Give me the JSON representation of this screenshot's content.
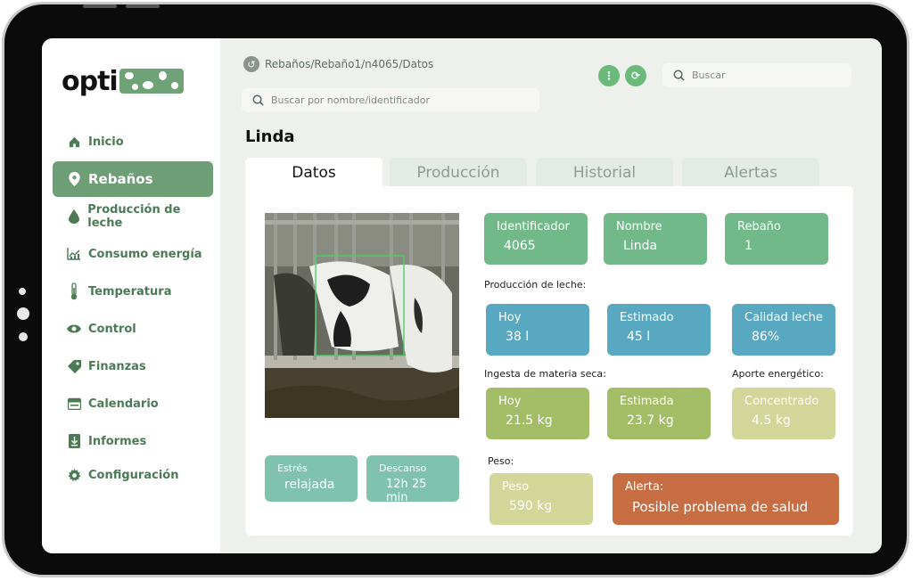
{
  "app": {
    "logo_text": "opti",
    "logo_badge": "muu"
  },
  "sidebar": {
    "items": [
      {
        "label": "Inicio",
        "icon": "home-icon",
        "active": false
      },
      {
        "label": "Rebaños",
        "icon": "location-pin-icon",
        "active": true
      },
      {
        "label": "Producción de leche",
        "icon": "drop-icon",
        "active": false
      },
      {
        "label": "Consumo energía",
        "icon": "chart-icon",
        "active": false
      },
      {
        "label": "Temperatura",
        "icon": "thermometer-icon",
        "active": false
      },
      {
        "label": "Control",
        "icon": "eye-icon",
        "active": false
      },
      {
        "label": "Finanzas",
        "icon": "tag-icon",
        "active": false
      },
      {
        "label": "Calendario",
        "icon": "calendar-icon",
        "active": false
      },
      {
        "label": "Informes",
        "icon": "download-icon",
        "active": false
      },
      {
        "label": "Configuración",
        "icon": "gear-icon",
        "active": false
      }
    ]
  },
  "header": {
    "breadcrumb": "Rebaños/Rebaño1/n4065/Datos",
    "search_main_placeholder": "Buscar por nombre/identificador",
    "search_top_placeholder": "Buscar"
  },
  "page": {
    "title": "Linda",
    "tabs": [
      {
        "label": "Datos",
        "active": true
      },
      {
        "label": "Producción",
        "active": false
      },
      {
        "label": "Historial",
        "active": false
      },
      {
        "label": "Alertas",
        "active": false
      }
    ]
  },
  "info": {
    "identificador": {
      "label": "Identificador",
      "value": "4065"
    },
    "nombre": {
      "label": "Nombre",
      "value": "Linda"
    },
    "rebano": {
      "label": "Rebaño",
      "value": "1"
    }
  },
  "milk": {
    "section": "Producción de leche:",
    "hoy": {
      "label": "Hoy",
      "value": "38 l"
    },
    "estimado": {
      "label": "Estimado",
      "value": "45 l"
    },
    "calidad": {
      "label": "Calidad leche",
      "value": "86%"
    }
  },
  "intake": {
    "section": "Ingesta de materia seca:",
    "hoy": {
      "label": "Hoy",
      "value": "21.5 kg"
    },
    "estimada": {
      "label": "Estimada",
      "value": "23.7 kg"
    }
  },
  "energy": {
    "section": "Aporte energético:",
    "concentrado": {
      "label": "Concentrado",
      "value": "4.5 kg"
    }
  },
  "weight": {
    "section": "Peso:",
    "peso": {
      "label": "Peso",
      "value": "590 kg"
    }
  },
  "status": {
    "estres": {
      "label": "Estrés",
      "value": "relajada"
    },
    "descanso": {
      "label": "Descanso",
      "value": "12h 25 min"
    }
  },
  "alert": {
    "label": "Alerta:",
    "value": "Posible problema de salud"
  },
  "colors": {
    "accent": "#6e9e76",
    "green": "#72b98a",
    "blue": "#58a8c2",
    "olive": "#a3bd67",
    "sand": "#d2d699",
    "teal": "#7fc2ad",
    "alert": "#c76d43"
  }
}
